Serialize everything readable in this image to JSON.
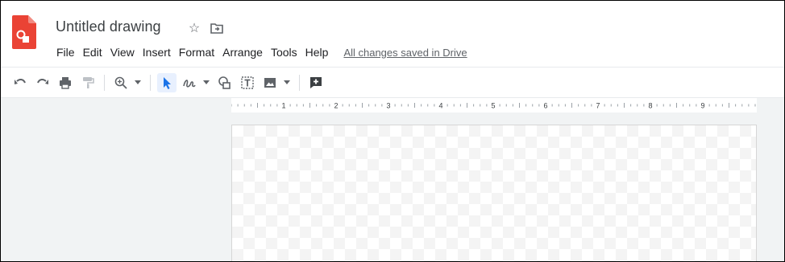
{
  "app": {
    "doc_title": "Untitled drawing",
    "star_icon": "star-icon",
    "move_icon": "folder-move-icon",
    "brand_color": "#ea4335"
  },
  "menu": {
    "items": [
      "File",
      "Edit",
      "View",
      "Insert",
      "Format",
      "Arrange",
      "Tools",
      "Help"
    ],
    "saved_status": "All changes saved in Drive"
  },
  "toolbar": {
    "buttons": [
      {
        "name": "undo-icon"
      },
      {
        "name": "redo-icon"
      },
      {
        "name": "print-icon"
      },
      {
        "name": "paint-format-icon"
      },
      {
        "name": "zoom-icon"
      },
      {
        "name": "select-icon",
        "active": true
      },
      {
        "name": "line-icon"
      },
      {
        "name": "shape-icon"
      },
      {
        "name": "text-box-icon"
      },
      {
        "name": "image-icon"
      },
      {
        "name": "new-comment-icon"
      }
    ],
    "accent": "#1a73e8"
  },
  "ruler": {
    "labels": [
      "1",
      "2",
      "3",
      "4",
      "5",
      "6",
      "7",
      "8",
      "9"
    ]
  }
}
